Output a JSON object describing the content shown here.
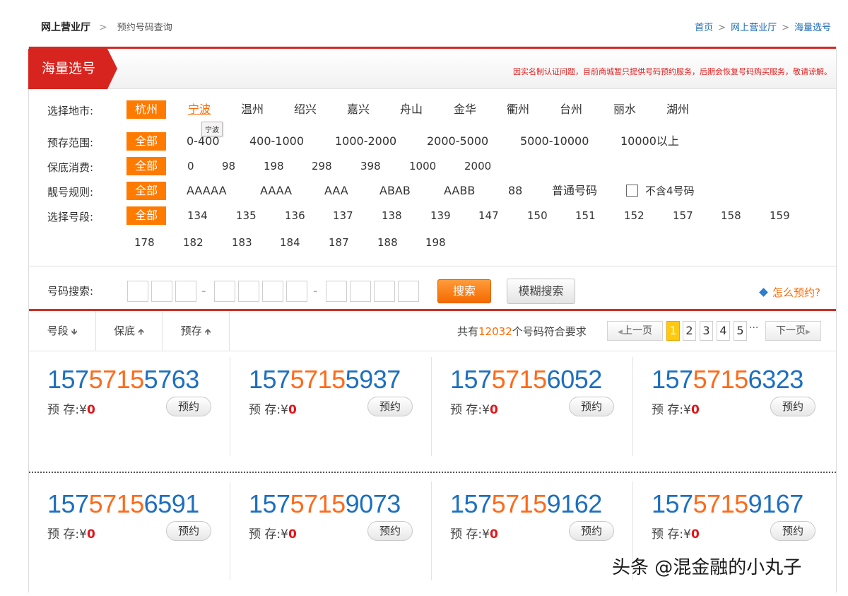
{
  "breadcrumb_left": {
    "home": "网上营业厅",
    "sep": ">",
    "current": "预约号码查询"
  },
  "breadcrumb_right": {
    "items": [
      "首页",
      "网上营业厅",
      "海量选号"
    ],
    "sep": ">"
  },
  "header": {
    "tab_title": "海量选号",
    "notice": "因实名制认证问题，目前商城暂只提供号码预约服务，后期会恢复号码购买服务，敬请谅解。"
  },
  "filters": {
    "city": {
      "label": "选择地市:",
      "options": [
        "杭州",
        "宁波",
        "温州",
        "绍兴",
        "嘉兴",
        "舟山",
        "金华",
        "衢州",
        "台州",
        "丽水",
        "湖州"
      ],
      "selected": "杭州",
      "hovered": "宁波",
      "tooltip": "宁波"
    },
    "deposit": {
      "label": "预存范围:",
      "options": [
        "全部",
        "0-400",
        "400-1000",
        "1000-2000",
        "2000-5000",
        "5000-10000",
        "10000以上"
      ],
      "selected": "全部"
    },
    "minimum": {
      "label": "保底消费:",
      "options": [
        "全部",
        "0",
        "98",
        "198",
        "298",
        "398",
        "1000",
        "2000"
      ],
      "selected": "全部"
    },
    "pattern": {
      "label": "靓号规则:",
      "options": [
        "全部",
        "AAAAA",
        "AAAA",
        "AAA",
        "ABAB",
        "AABB",
        "88",
        "普通号码"
      ],
      "selected": "全部",
      "checkbox_label": "不含4号码",
      "checkbox_checked": false
    },
    "segment": {
      "label": "选择号段:",
      "options": [
        "全部",
        "134",
        "135",
        "136",
        "137",
        "138",
        "139",
        "147",
        "150",
        "151",
        "152",
        "157",
        "158",
        "159",
        "178",
        "182",
        "183",
        "184",
        "187",
        "188",
        "198"
      ],
      "selected": "全部"
    }
  },
  "search": {
    "label": "号码搜索:",
    "search_button": "搜索",
    "fuzzy_button": "模糊搜索",
    "help_link": "怎么预约?"
  },
  "list": {
    "sort_columns": [
      {
        "label": "号段",
        "arrow": "down"
      },
      {
        "label": "保底",
        "arrow": "up"
      },
      {
        "label": "预存",
        "arrow": "up"
      }
    ],
    "count_prefix": "共有",
    "count_value": "12032",
    "count_suffix": "个号码符合要求",
    "pagination": {
      "prev": "上一页",
      "next": "下一页",
      "pages": [
        "1",
        "2",
        "3",
        "4",
        "5"
      ],
      "current": "1",
      "ellipsis": "···"
    }
  },
  "numbers": [
    {
      "a": "157",
      "b": "5715",
      "c": "5763",
      "deposit_label": "预 存:¥",
      "deposit": "0",
      "action": "预约"
    },
    {
      "a": "157",
      "b": "5715",
      "c": "5937",
      "deposit_label": "预 存:¥",
      "deposit": "0",
      "action": "预约"
    },
    {
      "a": "157",
      "b": "5715",
      "c": "6052",
      "deposit_label": "预 存:¥",
      "deposit": "0",
      "action": "预约"
    },
    {
      "a": "157",
      "b": "5715",
      "c": "6323",
      "deposit_label": "预 存:¥",
      "deposit": "0",
      "action": "预约"
    },
    {
      "a": "157",
      "b": "5715",
      "c": "6591",
      "deposit_label": "预 存:¥",
      "deposit": "0",
      "action": "预约"
    },
    {
      "a": "157",
      "b": "5715",
      "c": "9073",
      "deposit_label": "预 存:¥",
      "deposit": "0",
      "action": "预约"
    },
    {
      "a": "157",
      "b": "5715",
      "c": "9162",
      "deposit_label": "预 存:¥",
      "deposit": "0",
      "action": "预约"
    },
    {
      "a": "157",
      "b": "5715",
      "c": "9167",
      "deposit_label": "预 存:¥",
      "deposit": "0",
      "action": "预约"
    }
  ],
  "watermark": "头条 @混金融的小丸子",
  "colors": {
    "brand_red": "#d8241f",
    "accent_orange": "#ff7a00",
    "link_blue": "#1d6db5",
    "number_blue": "#1d6fc1",
    "number_orange": "#ff6a1a",
    "deposit_red": "#e3141a"
  }
}
